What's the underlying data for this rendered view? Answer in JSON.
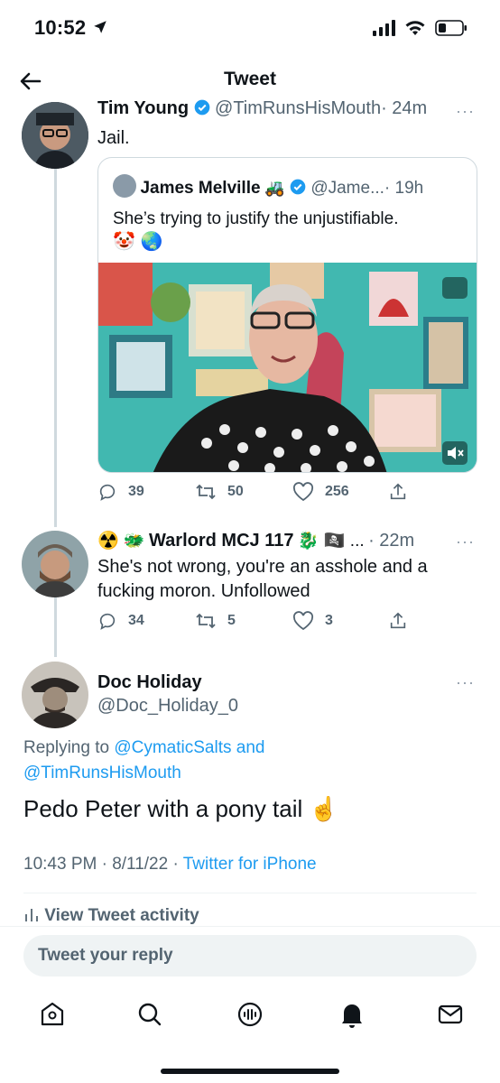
{
  "status": {
    "time": "10:52"
  },
  "header": {
    "title": "Tweet"
  },
  "tweet1": {
    "name": "Tim Young",
    "handle": "@TimRunsHisMouth",
    "time": "· 24m",
    "text": "Jail.",
    "more": "···"
  },
  "quote": {
    "name": "James Melville",
    "emoji": "🚜",
    "handle": "@Jame...",
    "time": "· 19h",
    "text": "She’s trying to justify the unjustifiable.",
    "emojis": "🤡 🌏"
  },
  "tweet1_actions": {
    "replies": "39",
    "retweets": "50",
    "likes": "256"
  },
  "tweet2": {
    "emoji_prefix": "☢️ 🐲",
    "name": "Warlord MCJ 117",
    "emoji_suffix": "🐉 🏴‍☠️ ...",
    "time": "· 22m",
    "text_line1": "She's not wrong, you're an asshole and a",
    "text_line2": "fucking moron. Unfollowed",
    "more": "···"
  },
  "tweet2_actions": {
    "replies": "34",
    "retweets": "5",
    "likes": "3"
  },
  "main_tweet": {
    "name": "Doc Holiday",
    "handle": "@Doc_Holiday_0",
    "replying_label": "Replying to",
    "replying_to1": "@CymaticSalts and",
    "replying_to2": "@TimRunsHisMouth",
    "text": "Pedo Peter with a pony tail ☝️",
    "timestamp": "10:43 PM · 8/11/22 ·",
    "source": "Twitter for iPhone",
    "activity": "View Tweet activity",
    "more": "···"
  },
  "reply": {
    "placeholder": "Tweet your reply"
  },
  "tabs": [
    "home-icon",
    "search-icon",
    "spaces-icon",
    "notifications-icon",
    "messages-icon"
  ]
}
